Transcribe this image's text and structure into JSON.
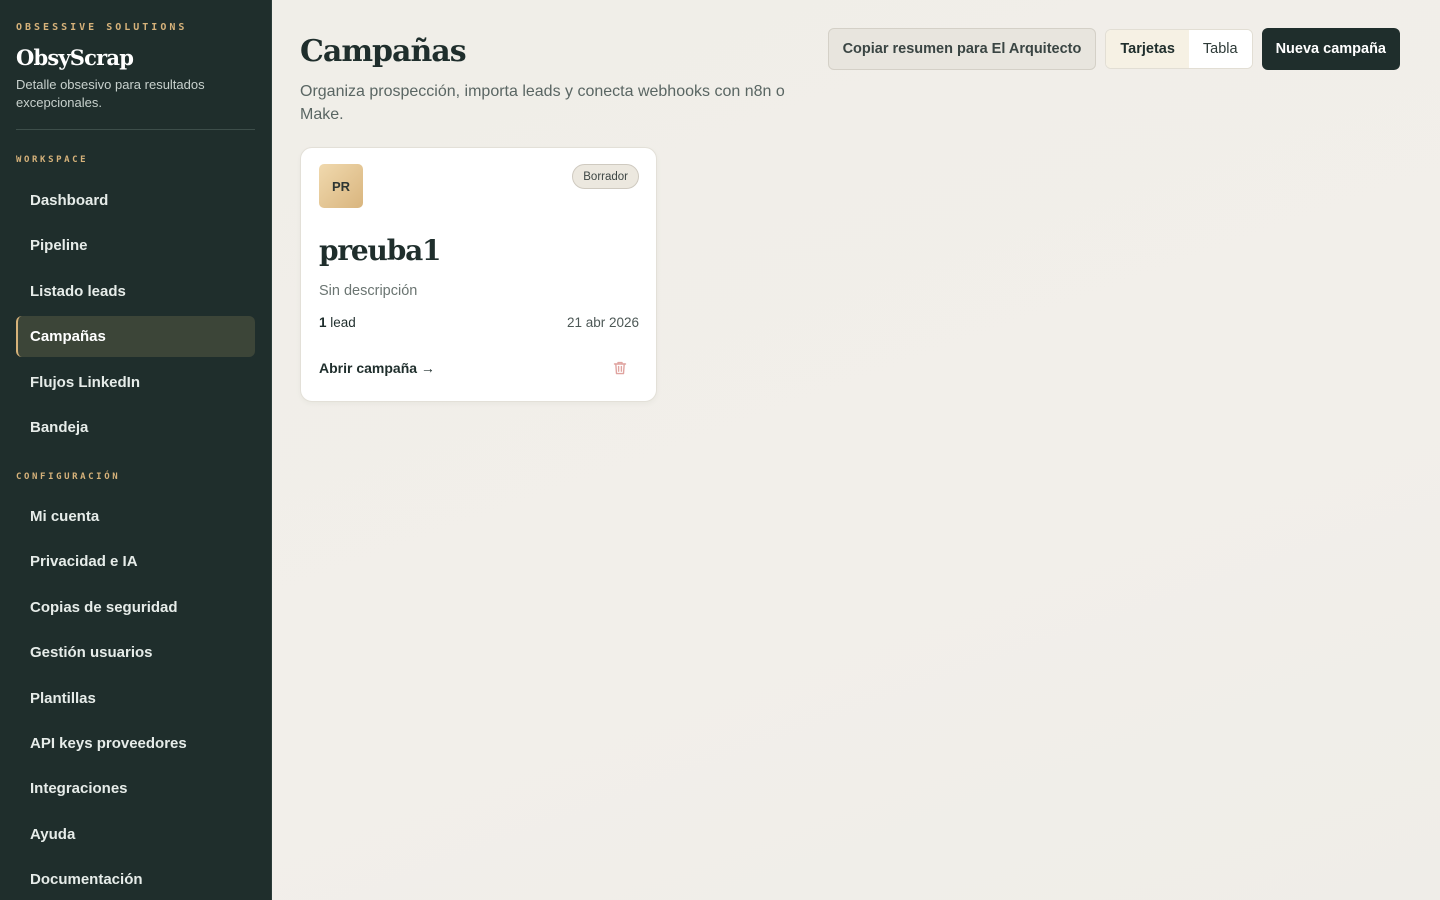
{
  "sidebar": {
    "eyebrow": "OBSESSIVE SOLUTIONS",
    "brand": "ObsyScrap",
    "tagline": "Detalle obsesivo para resultados excepcionales.",
    "workspace_label": "WORKSPACE",
    "workspace_items": [
      {
        "label": "Dashboard"
      },
      {
        "label": "Pipeline"
      },
      {
        "label": "Listado leads"
      },
      {
        "label": "Campañas",
        "active": true
      },
      {
        "label": "Flujos LinkedIn"
      },
      {
        "label": "Bandeja"
      }
    ],
    "config_label": "CONFIGURACIÓN",
    "config_items": [
      {
        "label": "Mi cuenta"
      },
      {
        "label": "Privacidad e IA"
      },
      {
        "label": "Copias de seguridad"
      },
      {
        "label": "Gestión usuarios"
      },
      {
        "label": "Plantillas"
      },
      {
        "label": "API keys proveedores"
      },
      {
        "label": "Integraciones"
      },
      {
        "label": "Ayuda"
      },
      {
        "label": "Documentación"
      }
    ]
  },
  "header": {
    "title": "Campañas",
    "subtitle": "Organiza prospección, importa leads y conecta webhooks con n8n o Make."
  },
  "toolbar": {
    "copy_label": "Copiar resumen para El Arquitecto",
    "view_cards": "Tarjetas",
    "view_table": "Tabla",
    "new_label": "Nueva campaña"
  },
  "campaigns": [
    {
      "initials": "PR",
      "status": "Borrador",
      "name": "preuba1",
      "description": "Sin descripción",
      "lead_number": "1",
      "lead_word": "lead",
      "date": "21 abr 2026",
      "open_label": "Abrir campaña →"
    }
  ],
  "colors": {
    "sidebar_bg": "#1f2e2c",
    "accent_gold": "#d6b27a",
    "primary_dark": "#1f2e2c",
    "danger_icon": "#e0a4a0"
  },
  "icons": {
    "delete": "trash-icon"
  }
}
